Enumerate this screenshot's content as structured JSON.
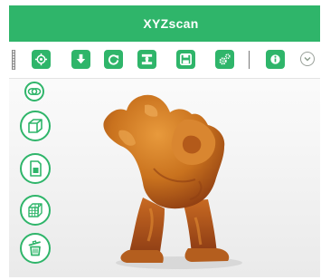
{
  "window": {
    "title": "XYZscan"
  },
  "colors": {
    "accent": "#2fb56a",
    "model_main": "#c9721e",
    "model_shadow": "#8e3d12"
  },
  "toolbar": {
    "buttons": [
      {
        "icon": "target-icon",
        "name": "scan-target-button"
      },
      {
        "icon": "download-icon",
        "name": "import-button"
      },
      {
        "icon": "refresh-icon",
        "name": "reset-view-button"
      },
      {
        "icon": "scanner-icon",
        "name": "scanner-button"
      },
      {
        "icon": "floppy-disk-icon",
        "name": "save-button"
      },
      {
        "icon": "gears-icon",
        "name": "settings-button"
      },
      {
        "icon": "info-icon",
        "name": "info-button"
      }
    ],
    "more_icon": "chevron-down-icon"
  },
  "sidebar": {
    "items": [
      {
        "icon": "view-toggle-icon",
        "name": "view-toggle-button"
      },
      {
        "icon": "cube-icon",
        "name": "cube-view-button"
      },
      {
        "icon": "sd-card-icon",
        "name": "sd-card-button"
      },
      {
        "icon": "grid-cube-icon",
        "name": "mesh-view-button"
      },
      {
        "icon": "trash-icon",
        "name": "delete-button"
      }
    ]
  },
  "viewport": {
    "model": "scanned-figure-model"
  }
}
